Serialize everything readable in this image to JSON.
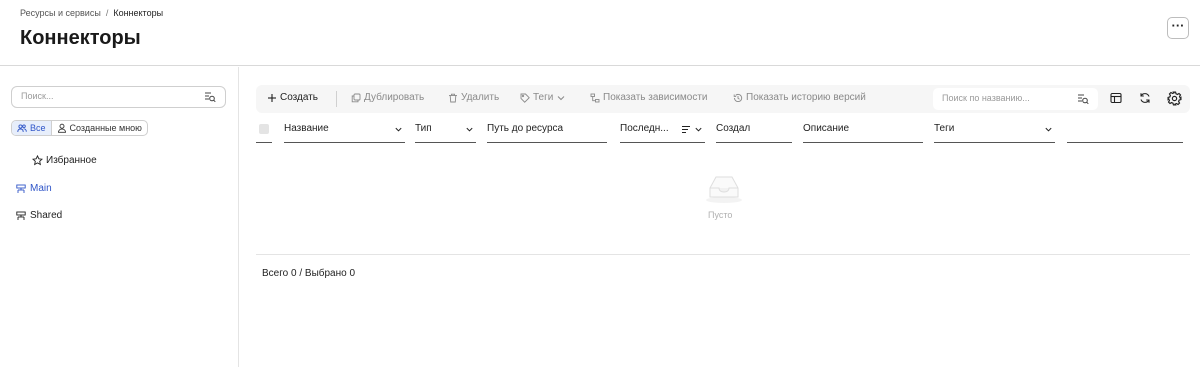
{
  "breadcrumb": {
    "parent": "Ресурсы и сервисы",
    "separator": "/",
    "current": "Коннекторы"
  },
  "page": {
    "title": "Коннекторы",
    "more_label": "···"
  },
  "sidebar": {
    "search_placeholder": "Поиск...",
    "filters": [
      {
        "label": "Все",
        "icon": "users-icon",
        "active": true
      },
      {
        "label": "Созданные мною",
        "icon": "user-icon",
        "active": false
      }
    ],
    "favorites_label": "Избранное",
    "tree": [
      {
        "label": "Main",
        "icon": "workspace-icon",
        "active": true
      },
      {
        "label": "Shared",
        "icon": "workspace-icon",
        "active": false
      }
    ]
  },
  "toolbar": {
    "create_label": "Создать",
    "duplicate_label": "Дублировать",
    "delete_label": "Удалить",
    "tags_label": "Теги",
    "dependencies_label": "Показать зависимости",
    "history_label": "Показать историю версий",
    "search_placeholder": "Поиск по названию..."
  },
  "table": {
    "columns": [
      "Название",
      "Тип",
      "Путь до ресурса",
      "Последн...",
      "Создал",
      "Описание",
      "Теги",
      ""
    ],
    "empty_text": "Пусто",
    "totals": "Всего 0 / Выбрано 0",
    "rows": []
  },
  "colors": {
    "accent": "#2f55c8",
    "toolbar_bg": "#f6f6f6",
    "border": "#d9d9d9"
  }
}
